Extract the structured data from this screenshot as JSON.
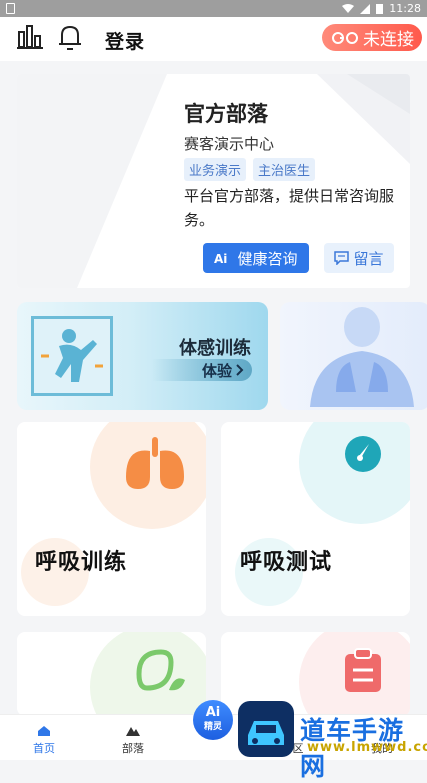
{
  "status_bar": {
    "time": "11:28"
  },
  "top_bar": {
    "login_label": "登录",
    "connection_status": "未连接"
  },
  "tribe_card": {
    "name": "官方部落",
    "subtitle": "赛客演示中心",
    "tags": [
      "业务演示",
      "主治医生"
    ],
    "description": "平台官方部落，提供日常咨询服务。",
    "consult_label": "健康咨询",
    "message_label": "留言"
  },
  "banners": {
    "somatosensory_title": "体感训练",
    "somatosensory_action": "体验"
  },
  "cards": {
    "breathing_training": "呼吸训练",
    "breathing_test": "呼吸测试"
  },
  "bottom_nav": {
    "items": [
      "首页",
      "部落",
      "区",
      "我的"
    ],
    "ai_label_top": "Ai",
    "ai_label_bottom": "精灵"
  },
  "watermark": {
    "name": "道车手游网",
    "url": "www.lmwwd.com"
  },
  "colors": {
    "primary": "#2f77e8",
    "danger": "#ff5a4c",
    "orange": "#f58d45",
    "teal": "#1fa6b8",
    "green": "#7bc96b",
    "red": "#ef6a6a"
  },
  "icons": [
    "chart-bars-icon",
    "bell-icon",
    "link-broken-icon",
    "ai-icon",
    "message-icon",
    "chevron-right-icon",
    "lungs-icon",
    "gauge-icon",
    "leaf-icon",
    "clipboard-icon",
    "home-icon",
    "mountain-icon"
  ]
}
